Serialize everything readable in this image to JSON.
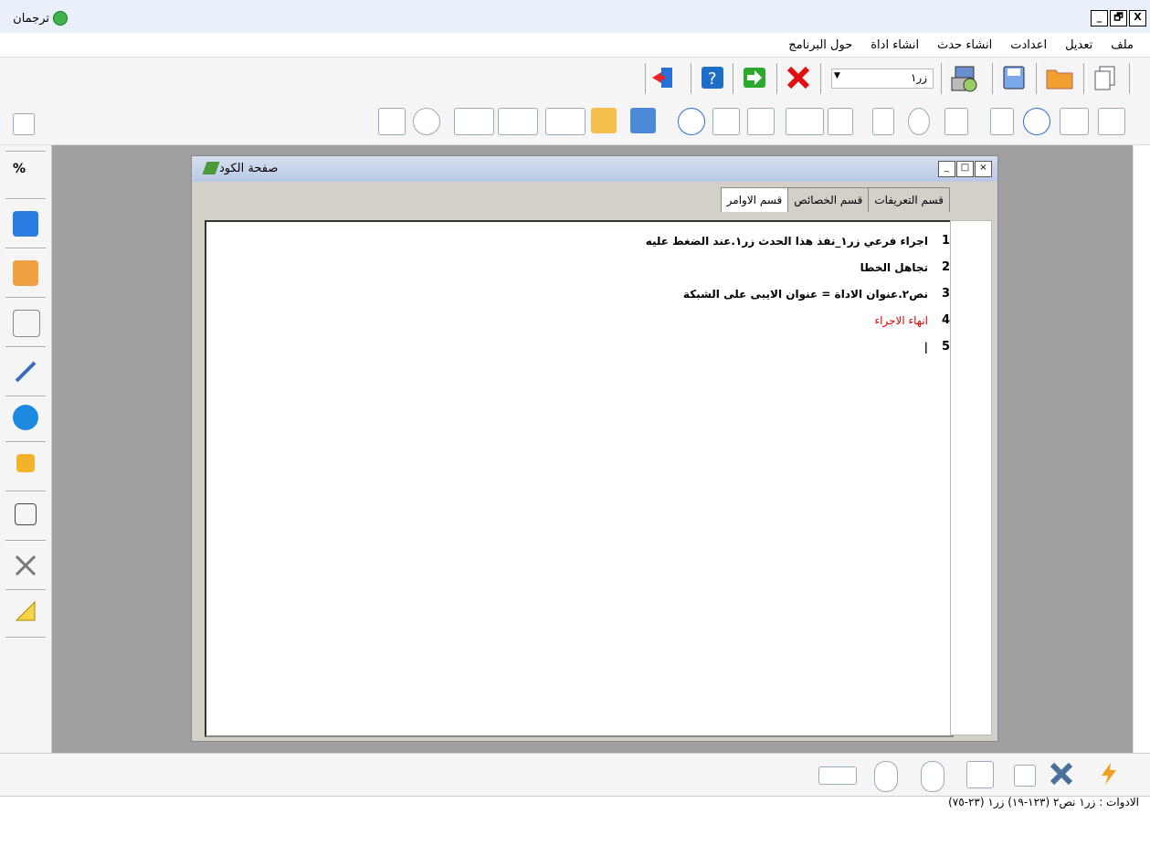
{
  "window": {
    "title": "ترجمان",
    "min": "_",
    "max": "🗗",
    "close": "X"
  },
  "menu": [
    "ملف",
    "تعديل",
    "اعدادت",
    "انشاء حدث",
    "انشاء اداة",
    "حول البرنامج"
  ],
  "toolbar": {
    "combo_value": "زر١"
  },
  "left_toolbar": {
    "percent_label": "%"
  },
  "code_window": {
    "title": "صفحة الكود",
    "tabs": [
      "قسم التعريفات",
      "قسم الخصائص",
      "قسم الاوامر"
    ],
    "lines": [
      {
        "num": "1",
        "text": "اجراء فرعي زر١_نفذ هذا الحدث زر١.عند الضغط عليه",
        "color": "#000000"
      },
      {
        "num": "2",
        "text": "تجاهل الخطا",
        "color": "#000000"
      },
      {
        "num": "3",
        "text": "نص٢.عنوان الاداة = عنوان الايبى على الشبكة",
        "color": "#000000"
      },
      {
        "num": "4",
        "text": "انهاء الاجراء",
        "color": "#e00000"
      },
      {
        "num": "5",
        "text": "",
        "color": "#000000"
      }
    ]
  },
  "status": {
    "label": "الادوات :",
    "value": "زر١ نص٢ (١٢٣-١٩) زر١ (٢٣-٧٥)"
  },
  "icons": [
    "exit-icon",
    "help-icon",
    "run-icon",
    "stop-icon",
    "package-icon",
    "save-icon",
    "folder-icon",
    "new-file-icon",
    "pointer-icon",
    "number-icon",
    "comment-icon",
    "list-icon",
    "radio-icon",
    "checkbox-icon",
    "progress-icon",
    "image-icon",
    "grid-icon",
    "xy-icon",
    "web-icon",
    "tree-icon",
    "hierarchy-icon",
    "listview-icon",
    "combo-icon",
    "frame-icon",
    "clock-icon",
    "form-icon",
    "doc-icon",
    "info-icon",
    "user-icon",
    "paint-icon",
    "pen-icon",
    "info-circle-icon",
    "layers-icon",
    "rectangle-icon",
    "tools-icon",
    "triangle-icon",
    "mouse-icon",
    "keyboard-icon",
    "lightning-icon"
  ]
}
